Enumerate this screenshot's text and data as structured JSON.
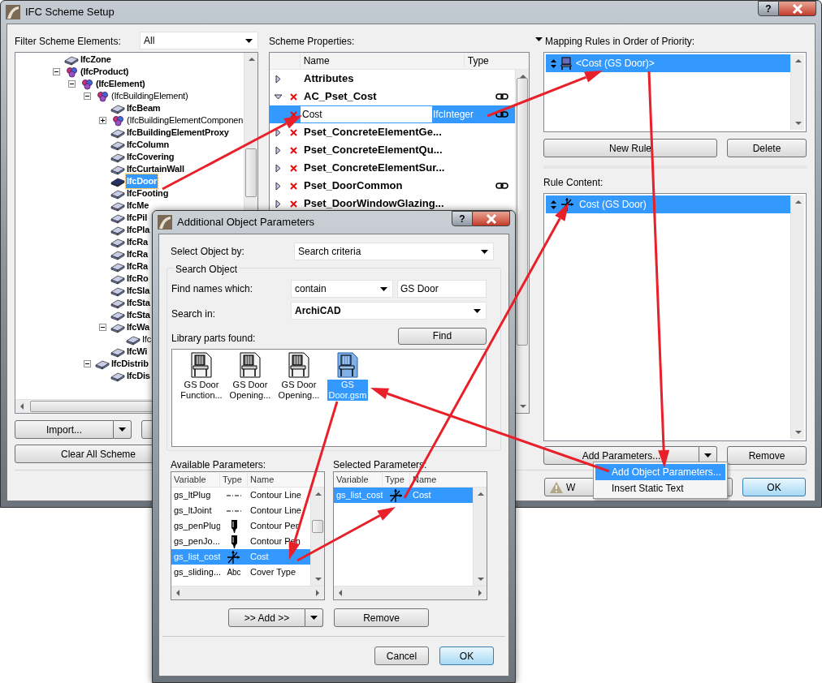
{
  "window": {
    "title": "IFC Scheme Setup",
    "help_label": "?"
  },
  "filter": {
    "label": "Filter Scheme Elements:",
    "value": "All"
  },
  "tree": {
    "items": [
      {
        "label": "IfcZone",
        "kind": "element",
        "bold": true,
        "selected": false
      },
      {
        "label": "(IfcProduct)",
        "kind": "abstract",
        "bold": true,
        "selected": false,
        "expanded": true,
        "children": [
          {
            "label": "(IfcElement)",
            "kind": "abstract",
            "bold": true,
            "selected": false,
            "expanded": true,
            "children": [
              {
                "label": "(IfcBuildingElement)",
                "kind": "abstract",
                "bold": false,
                "selected": false,
                "expanded": true,
                "children": [
                  {
                    "label": "IfcBeam",
                    "kind": "element",
                    "bold": true,
                    "selected": false
                  },
                  {
                    "label": "(IfcBuildingElementComponen",
                    "kind": "abstract",
                    "bold": false,
                    "selected": false,
                    "expanded": false
                  },
                  {
                    "label": "IfcBuildingElementProxy",
                    "kind": "element",
                    "bold": true,
                    "selected": false
                  },
                  {
                    "label": "IfcColumn",
                    "kind": "element",
                    "bold": true,
                    "selected": false
                  },
                  {
                    "label": "IfcCovering",
                    "kind": "element",
                    "bold": true,
                    "selected": false
                  },
                  {
                    "label": "IfcCurtainWall",
                    "kind": "element",
                    "bold": true,
                    "selected": false
                  },
                  {
                    "label": "IfcDoor",
                    "kind": "element",
                    "bold": true,
                    "selected": true
                  },
                  {
                    "label": "IfcFooting",
                    "kind": "element",
                    "bold": true,
                    "selected": false
                  },
                  {
                    "label": "IfcMe",
                    "kind": "element",
                    "bold": true,
                    "selected": false
                  },
                  {
                    "label": "IfcPil",
                    "kind": "element",
                    "bold": true,
                    "selected": false
                  },
                  {
                    "label": "IfcPla",
                    "kind": "element",
                    "bold": true,
                    "selected": false
                  },
                  {
                    "label": "IfcRa",
                    "kind": "element",
                    "bold": true,
                    "selected": false
                  },
                  {
                    "label": "IfcRa",
                    "kind": "element",
                    "bold": true,
                    "selected": false
                  },
                  {
                    "label": "IfcRa",
                    "kind": "element",
                    "bold": true,
                    "selected": false
                  },
                  {
                    "label": "IfcRo",
                    "kind": "element",
                    "bold": true,
                    "selected": false
                  },
                  {
                    "label": "IfcSla",
                    "kind": "element",
                    "bold": true,
                    "selected": false
                  },
                  {
                    "label": "IfcSta",
                    "kind": "element",
                    "bold": true,
                    "selected": false
                  },
                  {
                    "label": "IfcSta",
                    "kind": "element",
                    "bold": true,
                    "selected": false
                  },
                  {
                    "label": "IfcWa",
                    "kind": "element",
                    "bold": true,
                    "selected": false,
                    "expanded": true,
                    "children": [
                      {
                        "label": "Ifc",
                        "kind": "element",
                        "bold": false,
                        "selected": false
                      }
                    ]
                  },
                  {
                    "label": "IfcWi",
                    "kind": "element",
                    "bold": true,
                    "selected": false
                  }
                ]
              },
              {
                "label": "IfcDistrib",
                "kind": "element",
                "bold": true,
                "selected": false,
                "expanded": true,
                "children": [
                  {
                    "label": "IfcDis",
                    "kind": "element",
                    "bold": true,
                    "selected": false
                  }
                ]
              }
            ]
          }
        ]
      }
    ]
  },
  "import_button": "Import...",
  "clear_button": "Clear All Scheme",
  "properties": {
    "label": "Scheme Properties:",
    "columns": [
      "Name",
      "Type"
    ],
    "rows": [
      {
        "kind": "group",
        "name": "Attributes",
        "expanded": false,
        "removable": false,
        "linked": false,
        "selected": false
      },
      {
        "kind": "group",
        "name": "AC_Pset_Cost",
        "expanded": true,
        "removable": true,
        "linked": true,
        "selected": false
      },
      {
        "kind": "property",
        "name": "Cost",
        "type": "IfcInteger",
        "editing": true,
        "removable": true,
        "linked": true,
        "selected": true
      },
      {
        "kind": "group",
        "name": "Pset_ConcreteElementGe...",
        "expanded": false,
        "removable": true,
        "linked": false,
        "selected": false
      },
      {
        "kind": "group",
        "name": "Pset_ConcreteElementQu...",
        "expanded": false,
        "removable": true,
        "linked": false,
        "selected": false
      },
      {
        "kind": "group",
        "name": "Pset_ConcreteElementSur...",
        "expanded": false,
        "removable": true,
        "linked": false,
        "selected": false
      },
      {
        "kind": "group",
        "name": "Pset_DoorCommon",
        "expanded": false,
        "removable": true,
        "linked": true,
        "selected": false
      },
      {
        "kind": "group",
        "name": "Pset_DoorWindowGlazing...",
        "expanded": false,
        "removable": true,
        "linked": false,
        "selected": false
      }
    ]
  },
  "mapping": {
    "label": "Mapping Rules in Order of Priority:",
    "rules": [
      {
        "label": "<Cost (GS Door)>",
        "selected": true
      }
    ],
    "new_button": "New Rule",
    "delete_button": "Delete"
  },
  "rule_content": {
    "label": "Rule Content:",
    "items": [
      {
        "label": "Cost (GS Door)",
        "selected": true
      }
    ],
    "add_button": "Add Parameters...",
    "remove_button": "Remove"
  },
  "add_menu": {
    "items": [
      {
        "label": "Add Object Parameters...",
        "selected": true
      },
      {
        "label": "Insert Static Text",
        "selected": false
      }
    ]
  },
  "footer": {
    "warning_button": "W",
    "ok_button": "OK"
  },
  "dialog": {
    "title": "Additional Object Parameters",
    "help_label": "?",
    "select_by": {
      "label": "Select Object by:",
      "value": "Search criteria"
    },
    "group_title": "Search Object",
    "find_names": {
      "label": "Find names which:",
      "mode": "contain",
      "value": "GS Door"
    },
    "search_in": {
      "label": "Search in:",
      "value": "ArchiCAD"
    },
    "found_label": "Library parts found:",
    "find_button": "Find",
    "parts": [
      {
        "lines": [
          "GS Door",
          "Function..."
        ],
        "selected": false
      },
      {
        "lines": [
          "GS Door",
          "Opening..."
        ],
        "selected": false
      },
      {
        "lines": [
          "GS Door",
          "Opening..."
        ],
        "selected": false
      },
      {
        "lines": [
          "GS",
          "Door.gsm"
        ],
        "selected": true
      }
    ],
    "available": {
      "label": "Available Parameters:",
      "columns": [
        "Variable",
        "Type",
        "Name"
      ],
      "rows": [
        {
          "variable": "gs_ltPlug",
          "kind": "line",
          "name": "Contour Line",
          "selected": false
        },
        {
          "variable": "gs_ltJoint",
          "kind": "line",
          "name": "Contour Line",
          "selected": false
        },
        {
          "variable": "gs_penPlug",
          "kind": "pen",
          "name": "Contour Pen",
          "selected": false
        },
        {
          "variable": "gs_penJo...",
          "kind": "pen",
          "name": "Contour Pen",
          "selected": false
        },
        {
          "variable": "gs_list_cost",
          "kind": "measure",
          "name": "Cost",
          "selected": true
        },
        {
          "variable": "gs_sliding...",
          "kind": "text",
          "type_label": "Abc",
          "name": "Cover Type",
          "selected": false
        }
      ]
    },
    "selected_params": {
      "label": "Selected Parameters:",
      "columns": [
        "Variable",
        "Type",
        "Name"
      ],
      "rows": [
        {
          "variable": "gs_list_cost",
          "kind": "measure",
          "name": "Cost",
          "selected": true
        }
      ]
    },
    "add_button": ">> Add >>",
    "remove_button": "Remove",
    "cancel_button": "Cancel",
    "ok_button": "OK"
  }
}
